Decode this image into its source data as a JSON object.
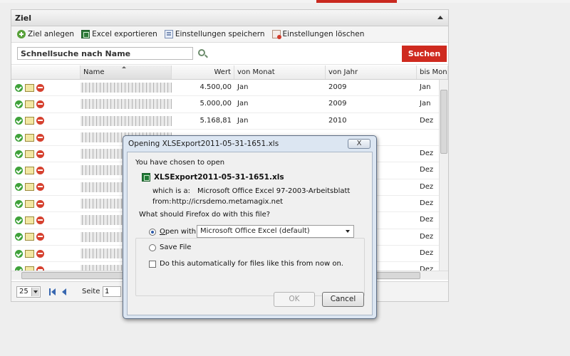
{
  "panel": {
    "title": "Ziel"
  },
  "toolbar": {
    "add_label": "Ziel anlegen",
    "export_label": "Excel exportieren",
    "save_settings_label": "Einstellungen speichern",
    "delete_settings_label": "Einstellungen löschen"
  },
  "search": {
    "placeholder": "Schnellsuche nach Name",
    "button_label": "Suchen"
  },
  "grid": {
    "columns": [
      "",
      "Name",
      "Wert",
      "von Monat",
      "von Jahr",
      "bis Monat"
    ],
    "rows": [
      {
        "wert": "4.500,00",
        "von_monat": "Jan",
        "von_jahr": "2009",
        "bis_monat": "Jan"
      },
      {
        "wert": "5.000,00",
        "von_monat": "Jan",
        "von_jahr": "2009",
        "bis_monat": "Jan"
      },
      {
        "wert": "5.168,81",
        "von_monat": "Jan",
        "von_jahr": "2010",
        "bis_monat": "Dez"
      },
      {
        "wert": "",
        "von_monat": "",
        "von_jahr": "",
        "bis_monat": ""
      },
      {
        "wert": "",
        "von_monat": "",
        "von_jahr": "",
        "bis_monat": "Dez"
      },
      {
        "wert": "",
        "von_monat": "",
        "von_jahr": "",
        "bis_monat": "Dez"
      },
      {
        "wert": "",
        "von_monat": "",
        "von_jahr": "",
        "bis_monat": "Dez"
      },
      {
        "wert": "",
        "von_monat": "",
        "von_jahr": "",
        "bis_monat": "Dez"
      },
      {
        "wert": "",
        "von_monat": "",
        "von_jahr": "",
        "bis_monat": "Dez"
      },
      {
        "wert": "",
        "von_monat": "",
        "von_jahr": "",
        "bis_monat": "Dez"
      },
      {
        "wert": "",
        "von_monat": "",
        "von_jahr": "",
        "bis_monat": "Dez"
      },
      {
        "wert": "",
        "von_monat": "",
        "von_jahr": "",
        "bis_monat": "Dez"
      }
    ]
  },
  "pager": {
    "page_size": "25",
    "page_label": "Seite",
    "page_value": "1"
  },
  "dialog": {
    "title": "Opening XLSExport2011-05-31-1651.xls",
    "close_label": "X",
    "intro": "You have chosen to open",
    "filename": "XLSExport2011-05-31-1651.xls",
    "which_is_label": "which is a:",
    "which_is_value": "Microsoft Office Excel 97-2003-Arbeitsblatt",
    "from_label": "from:",
    "from_value": "http://icrsdemo.metamagix.net",
    "question": "What should Firefox do with this file?",
    "open_with_label": "Open with",
    "open_with_app": "Microsoft Office Excel (default)",
    "save_file_label": "Save File",
    "auto_label": "Do this automatically for files like this from now on.",
    "ok_label": "OK",
    "cancel_label": "Cancel"
  },
  "colors": {
    "accent_red": "#cf2a1f",
    "dialog_frame": "#dce6f2"
  }
}
